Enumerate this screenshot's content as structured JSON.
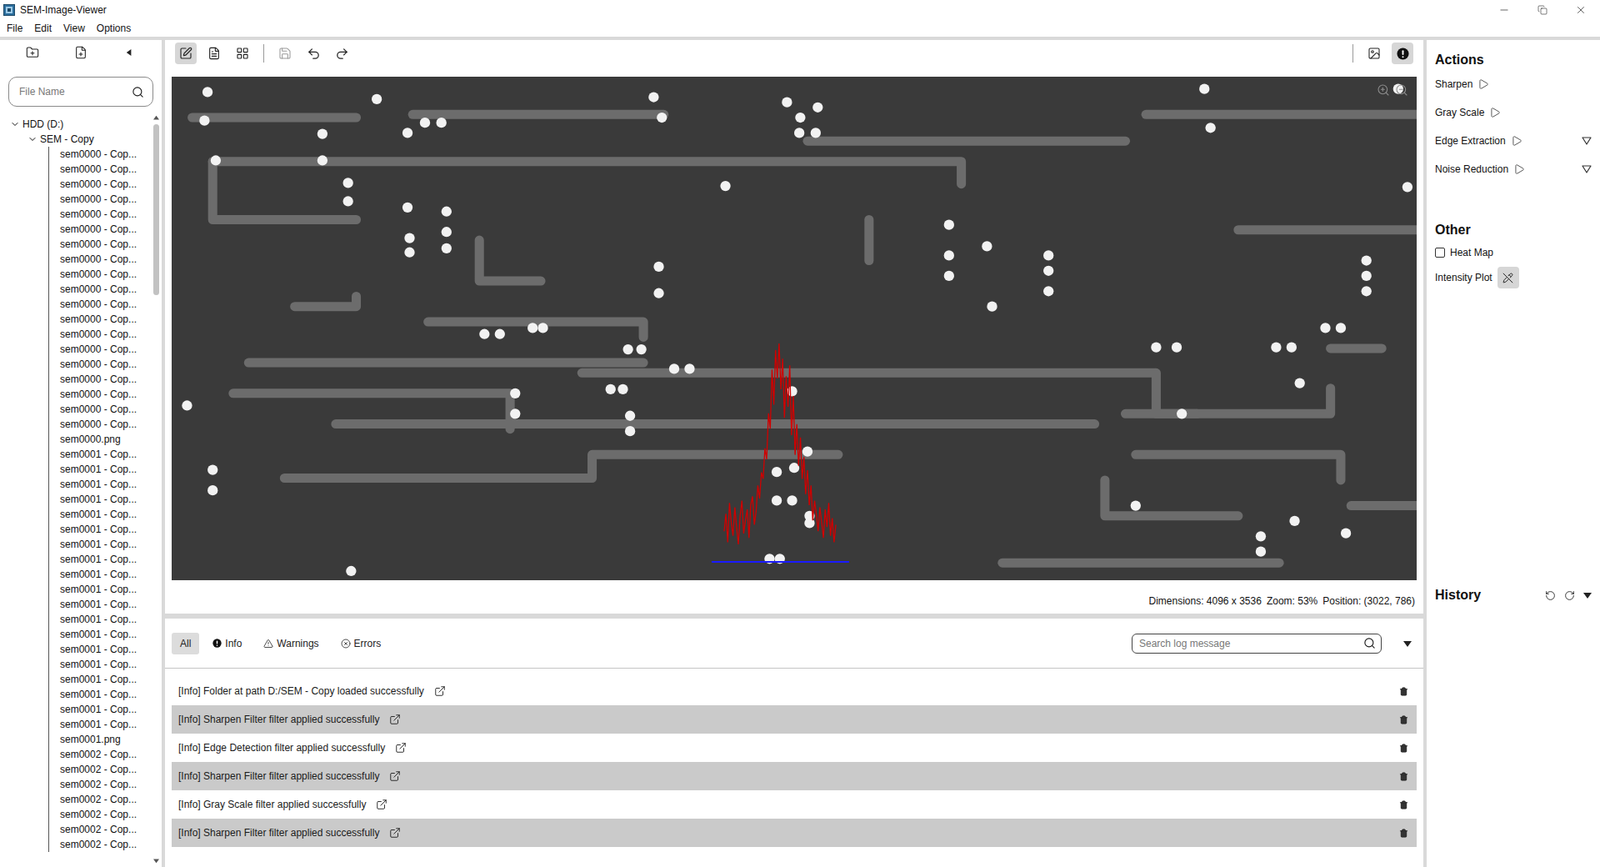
{
  "window": {
    "title": "SEM-Image-Viewer"
  },
  "menu": [
    "File",
    "Edit",
    "View",
    "Options"
  ],
  "sidebar": {
    "search": {
      "placeholder": "File Name"
    },
    "tree": {
      "drive": {
        "label": "HDD (D:)",
        "expanded": true,
        "selected": false
      },
      "folder": {
        "label": "SEM - Copy",
        "expanded": true,
        "selected": false
      },
      "files": [
        {
          "label": "sem0000 - Cop...",
          "selected": false
        },
        {
          "label": "sem0000 - Cop...",
          "selected": false
        },
        {
          "label": "sem0000 - Cop...",
          "selected": false
        },
        {
          "label": "sem0000 - Cop...",
          "selected": false
        },
        {
          "label": "sem0000 - Cop...",
          "selected": false
        },
        {
          "label": "sem0000 - Cop...",
          "selected": false
        },
        {
          "label": "sem0000 - Cop...",
          "selected": false
        },
        {
          "label": "sem0000 - Cop...",
          "selected": false
        },
        {
          "label": "sem0000 - Cop...",
          "selected": false
        },
        {
          "label": "sem0000 - Cop...",
          "selected": false
        },
        {
          "label": "sem0000 - Cop...",
          "selected": false
        },
        {
          "label": "sem0000 - Cop...",
          "selected": false
        },
        {
          "label": "sem0000 - Cop...",
          "selected": false
        },
        {
          "label": "sem0000 - Cop...",
          "selected": false
        },
        {
          "label": "sem0000 - Cop...",
          "selected": false
        },
        {
          "label": "sem0000 - Cop...",
          "selected": false
        },
        {
          "label": "sem0000 - Cop...",
          "selected": false
        },
        {
          "label": "sem0000 - Cop...",
          "selected": false
        },
        {
          "label": "sem0000 - Cop...",
          "selected": false
        },
        {
          "label": "sem0000.png",
          "selected": false
        },
        {
          "label": "sem0001 - Cop...",
          "selected": false
        },
        {
          "label": "sem0001 - Cop...",
          "selected": false
        },
        {
          "label": "sem0001 - Cop...",
          "selected": false
        },
        {
          "label": "sem0001 - Cop...",
          "selected": false
        },
        {
          "label": "sem0001 - Cop...",
          "selected": false
        },
        {
          "label": "sem0001 - Cop...",
          "selected": false
        },
        {
          "label": "sem0001 - Cop...",
          "selected": false
        },
        {
          "label": "sem0001 - Cop...",
          "selected": false
        },
        {
          "label": "sem0001 - Cop...",
          "selected": false
        },
        {
          "label": "sem0001 - Cop...",
          "selected": false
        },
        {
          "label": "sem0001 - Cop...",
          "selected": false
        },
        {
          "label": "sem0001 - Cop...",
          "selected": false
        },
        {
          "label": "sem0001 - Cop...",
          "selected": false
        },
        {
          "label": "sem0001 - Cop...",
          "selected": false
        },
        {
          "label": "sem0001 - Cop...",
          "selected": false
        },
        {
          "label": "sem0001 - Cop...",
          "selected": false
        },
        {
          "label": "sem0001 - Cop...",
          "selected": false
        },
        {
          "label": "sem0001 - Cop...",
          "selected": false
        },
        {
          "label": "sem0001 - Cop...",
          "selected": false
        },
        {
          "label": "sem0001.png",
          "selected": false
        },
        {
          "label": "sem0002 - Cop...",
          "selected": false
        },
        {
          "label": "sem0002 - Cop...",
          "selected": false
        },
        {
          "label": "sem0002 - Cop...",
          "selected": false
        },
        {
          "label": "sem0002 - Cop...",
          "selected": false
        },
        {
          "label": "sem0002 - Cop...",
          "selected": false
        },
        {
          "label": "sem0002 - Cop...",
          "selected": false
        },
        {
          "label": "sem0002 - Cop...",
          "selected": false
        }
      ]
    }
  },
  "toolbar": {
    "tools": [
      {
        "selected": true
      },
      {
        "selected": false
      },
      {
        "selected": false
      }
    ],
    "save": {
      "disabled": true
    },
    "undo": {
      "disabled": false
    },
    "redo": {
      "disabled": false
    },
    "view_toggles": [
      {
        "selected": false
      },
      {
        "selected": true
      }
    ]
  },
  "image": {
    "intensity_plot": {
      "values": [
        14,
        22,
        9,
        27,
        18,
        12,
        25,
        16,
        8,
        21,
        28,
        13,
        19,
        24,
        11,
        26,
        30,
        17,
        23,
        35,
        29,
        41,
        38,
        52,
        47,
        68,
        61,
        88,
        72,
        97,
        84,
        100,
        79,
        93,
        66,
        85,
        71,
        90,
        58,
        76,
        49,
        63,
        44,
        57,
        38,
        48,
        31,
        42,
        26,
        35,
        19,
        28,
        22,
        14,
        25,
        18,
        11,
        24,
        16,
        27,
        12,
        20,
        9,
        17
      ]
    }
  },
  "status_bar": [
    "Dimensions: 4096 x 3536",
    "Zoom: 53%",
    "Position: (3022, 786)"
  ],
  "log": {
    "filters": [
      {
        "label": "All",
        "kind": "all",
        "selected": true
      },
      {
        "label": "Info",
        "kind": "info",
        "selected": false
      },
      {
        "label": "Warnings",
        "kind": "warning",
        "selected": false
      },
      {
        "label": "Errors",
        "kind": "error",
        "selected": false
      }
    ],
    "search": {
      "placeholder": "Search log message"
    },
    "entries": [
      {
        "text": "[Info] Folder at path D:/SEM - Copy loaded successfully"
      },
      {
        "text": "[Info] Sharpen Filter filter applied successfully"
      },
      {
        "text": "[Info] Edge Detection filter applied successfully"
      },
      {
        "text": "[Info] Sharpen Filter filter applied successfully"
      },
      {
        "text": "[Info] Gray Scale filter applied successfully"
      },
      {
        "text": "[Info] Sharpen Filter filter applied successfully"
      }
    ]
  },
  "actions": {
    "title": "Actions",
    "items": [
      {
        "label": "Sharpen",
        "has_options": false
      },
      {
        "label": "Gray Scale",
        "has_options": false
      },
      {
        "label": "Edge Extraction",
        "has_options": true
      },
      {
        "label": "Noise Reduction",
        "has_options": true
      }
    ]
  },
  "other": {
    "title": "Other",
    "heat_map": {
      "label": "Heat Map",
      "checked": false
    },
    "intensity_plot": {
      "label": "Intensity Plot",
      "on": true
    }
  },
  "history": {
    "title": "History"
  }
}
